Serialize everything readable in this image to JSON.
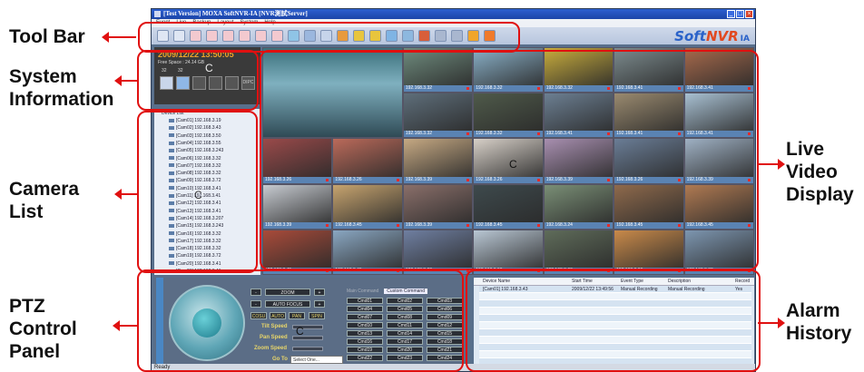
{
  "labels": {
    "toolbar": "Tool Bar",
    "system_info": "System\nInformation",
    "camera_list": "Camera\nList",
    "ptz": "PTZ\nControl\nPanel",
    "live_video": "Live\nVideo\nDisplay",
    "alarm": "Alarm\nHistory"
  },
  "window": {
    "title": "[Test Version] MOXA SoftNVR-IA [NVR測試Server]",
    "menu": [
      "Event",
      "Live",
      "Backup",
      "Layout",
      "System",
      "Help"
    ],
    "brand_soft": "Soft",
    "brand_nvr": "NVR",
    "brand_ia": "IA",
    "status": "Ready"
  },
  "toolbar_colors": [
    "#dfe6f3",
    "#dfe6f3",
    "#f3c9cf",
    "#f3c9cf",
    "#f3c9cf",
    "#f3c9cf",
    "#f3c9cf",
    "#f3c9cf",
    "#8fc4e6",
    "#9bb7de",
    "#c6d4ea",
    "#e89a3d",
    "#e8c53d",
    "#e8c53d",
    "#7fb4e4",
    "#8db8df",
    "#d85e3a",
    "#a9b7cf",
    "#a9b7cf",
    "#f0a52a",
    "#f07a2a"
  ],
  "system": {
    "datetime": "2009/12/22 13:50:05",
    "free_space": "Free Space : 24.14 GB",
    "label_a": "32",
    "label_b": "32",
    "c_marker": "C",
    "dipc": "DIPC"
  },
  "camera_list": {
    "header": "Device List",
    "c_marker": "C",
    "items": [
      "[Cam01] 192.168.3.19",
      "[Cam02] 192.168.3.43",
      "[Cam03] 192.168.3.50",
      "[Cam04] 192.168.3.55",
      "[Cam05] 192.168.3.243",
      "[Cam06] 192.168.3.32",
      "[Cam07] 192.168.3.32",
      "[Cam08] 192.168.3.32",
      "[Cam09] 192.168.3.72",
      "[Cam10] 192.168.3.41",
      "[Cam11] 192.168.3.41",
      "[Cam12] 192.168.3.41",
      "[Cam13] 192.168.3.41",
      "[Cam14] 192.168.3.207",
      "[Cam15] 192.168.3.243",
      "[Cam16] 192.168.3.32",
      "[Cam17] 192.168.3.32",
      "[Cam18] 192.168.3.32",
      "[Cam19] 192.168.3.72",
      "[Cam20] 192.168.3.41",
      "[Cam21] 192.168.3.41"
    ]
  },
  "video": {
    "c_marker": "C",
    "tiles": [
      {
        "label": "192.168.3.32",
        "color": "#6f8c7e"
      },
      {
        "label": "192.168.3.32",
        "color": "#8ab1c9"
      },
      {
        "label": "192.168.3.32",
        "color": "#c9ad3d"
      },
      {
        "label": "192.168.3.41",
        "color": "#7d8c8f"
      },
      {
        "label": "192.168.3.41",
        "color": "#a86a4c"
      },
      {
        "label": "192.168.3.32",
        "color": "#5e6e7a"
      },
      {
        "label": "192.168.3.32",
        "color": "#4f5a4a"
      },
      {
        "label": "192.168.3.41",
        "color": "#6c7f92"
      },
      {
        "label": "192.168.3.41",
        "color": "#9a8a6f"
      },
      {
        "label": "192.168.3.41",
        "color": "#a8c0d2"
      },
      {
        "label": "192.168.3.26",
        "color": "#9a4a4a"
      },
      {
        "label": "192.168.3.26",
        "color": "#bb6a5a"
      },
      {
        "label": "192.168.3.39",
        "color": "#c6a983"
      },
      {
        "label": "192.168.3.26",
        "color": "#d7d0c8"
      },
      {
        "label": "192.168.3.39",
        "color": "#a88fb0"
      },
      {
        "label": "192.168.3.26",
        "color": "#6a7d96"
      },
      {
        "label": "192.168.3.39",
        "color": "#9fb1c4"
      },
      {
        "label": "192.168.3.39",
        "color": "#c7cbd1"
      },
      {
        "label": "192.168.3.45",
        "color": "#c7a46f"
      },
      {
        "label": "192.168.3.39",
        "color": "#8a6f6a"
      },
      {
        "label": "192.168.3.45",
        "color": "#3e4a4d"
      },
      {
        "label": "192.168.3.24",
        "color": "#7a8f76"
      },
      {
        "label": "192.168.3.45",
        "color": "#8f6a4c"
      },
      {
        "label": "192.168.3.45",
        "color": "#b07a52"
      },
      {
        "label": "192.168.3.45",
        "color": "#a94b3a"
      },
      {
        "label": "192.168.3.45",
        "color": "#8aa7c2"
      },
      {
        "label": "192.168.3.60",
        "color": "#6f7fa1"
      },
      {
        "label": "192.168.3.60",
        "color": "#b9c7d4"
      },
      {
        "label": "192.168.3.60",
        "color": "#5f6c5a"
      },
      {
        "label": "192.168.3.60",
        "color": "#c98a4a"
      },
      {
        "label": "192.168.3.30",
        "color": "#7d96b0"
      },
      {
        "label": "192.168.3.20",
        "color": "#a7b4c0"
      },
      {
        "label": "192.168.3.45",
        "color": "#9b6d59"
      },
      {
        "label": "192.168.3.45",
        "color": "#86a0ba"
      },
      {
        "label": "192.168.3.45",
        "color": "#6a5c4c"
      },
      {
        "label": "192.168.3.45",
        "color": "#b59b7c"
      }
    ]
  },
  "ptz": {
    "side_label": "PTZ Control",
    "zoom": "ZOOM",
    "auto_focus": "AUTO FOCUS",
    "cosu": "COSU",
    "auto": "AUTO",
    "pan": "PAN",
    "spin": "SPIN",
    "tilt": "Tilt Speed",
    "pan_speed": "Pan Speed",
    "zoom_speed": "Zoom Speed",
    "c_marker": "C",
    "goto": "Go To",
    "select": "Select One...",
    "tab_a": "Main Command",
    "tab_b": "Custom Command",
    "commands": [
      "Cmd01",
      "Cmd02",
      "Cmd03",
      "Cmd04",
      "Cmd05",
      "Cmd06",
      "Cmd07",
      "Cmd08",
      "Cmd09",
      "Cmd10",
      "Cmd11",
      "Cmd12",
      "Cmd13",
      "Cmd14",
      "Cmd15",
      "Cmd16",
      "Cmd17",
      "Cmd18",
      "Cmd19",
      "Cmd20",
      "Cmd21",
      "Cmd22",
      "Cmd23",
      "Cmd24"
    ]
  },
  "alarm": {
    "side_label": "Alarm History",
    "columns": [
      "Device Name",
      "Start Time",
      "Event Type",
      "Description",
      "Record"
    ],
    "rows": [
      [
        "[Cam01] 192.168.3.43",
        "2009/12/22 13:49:56",
        "Manual Recording",
        "Manual Recording",
        "Yes"
      ]
    ],
    "c_marker": "C"
  }
}
